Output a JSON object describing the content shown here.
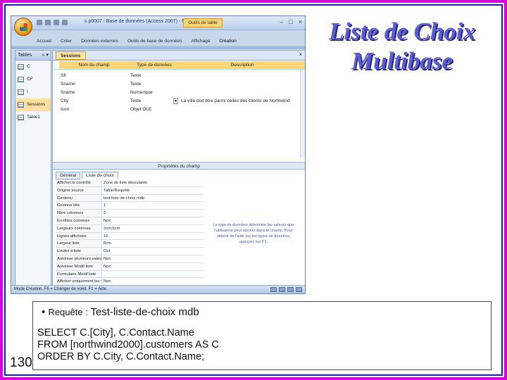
{
  "slide": {
    "title_line1": "Liste de Choix",
    "title_line2": "Multibase",
    "page_number": "130",
    "colors": {
      "frame_outer": "#d400d4",
      "frame_inner": "#1a1aa8",
      "title": "#5b5bd6"
    }
  },
  "screenshot": {
    "window_title": "s p0007 : Base de données (Access 2007) - Mi",
    "context_tab": "Outils de table",
    "window_controls": [
      "–",
      "□",
      "×"
    ],
    "ribbon_tabs": [
      "Accueil",
      "Créer",
      "Données externes",
      "Outils de base de données",
      "Affichage",
      "Création"
    ],
    "nav": {
      "header": "Tables",
      "chevron": "« ▾",
      "items": [
        {
          "label": "C",
          "selected": false
        },
        {
          "label": "CF",
          "selected": false
        },
        {
          "label": "I",
          "selected": false
        },
        {
          "label": "Sessions",
          "selected": true
        },
        {
          "label": "Table1",
          "selected": false
        }
      ]
    },
    "doc": {
      "tab_label": "Sessions",
      "close": "×",
      "columns": {
        "name": "Nom du champ",
        "type": "Type de données",
        "description": "Description"
      },
      "fields": [
        {
          "name": "SfI",
          "type": "Texte",
          "description": ""
        },
        {
          "name": "Sname",
          "type": "Texte",
          "description": ""
        },
        {
          "name": "Sname",
          "type": "Numérique",
          "description": ""
        },
        {
          "name": "City",
          "type": "Texte",
          "description": "La ville doit être parmi celles des clients de Northwind"
        },
        {
          "name": "Icon",
          "type": "Objet OLE",
          "description": ""
        }
      ],
      "properties_title": "Propriétés du champ",
      "property_tabs": [
        "Général",
        "Liste de choix"
      ],
      "properties": [
        {
          "key": "Afficher le contrôle",
          "value": "Zone de liste déroulante"
        },
        {
          "key": "Origine source",
          "value": "Table/Requête"
        },
        {
          "key": "Contenu",
          "value": "test-liste-de-choix mdb"
        },
        {
          "key": "Colonne liée",
          "value": "1"
        },
        {
          "key": "Nbre colonnes",
          "value": "2"
        },
        {
          "key": "En-têtes colonnes",
          "value": "Non"
        },
        {
          "key": "Largeurs colonnes",
          "value": "2cm;6cm"
        },
        {
          "key": "Lignes affichées",
          "value": "16"
        },
        {
          "key": "Largeur liste",
          "value": "8cm"
        },
        {
          "key": "Limiter à liste",
          "value": "Oui"
        },
        {
          "key": "Autoriser plusieurs valeurs",
          "value": "Non"
        },
        {
          "key": "Autoriser Modif liste",
          "value": "Non"
        },
        {
          "key": "Formulaire Modif liste",
          "value": ""
        },
        {
          "key": "Afficher uniquement les valeurs",
          "value": "Non"
        }
      ],
      "help_text": "Le type de données détermine les valeurs que l'utilisateur peut stocker dans le champ. Pour obtenir de l'aide sur les types de données, appuyez sur F1."
    },
    "status_text": "Mode Création. F6 = Changer de volet. F1 = Aide."
  },
  "query": {
    "bullet": "•",
    "label_prefix": "Requête : ",
    "label_name": "Test-liste-de-choix mdb",
    "sql_lines": [
      "SELECT C.[City], C.Contact.Name",
      "FROM [northwind2000].customers AS C",
      "ORDER BY C.City, C.Contact.Name;"
    ]
  }
}
